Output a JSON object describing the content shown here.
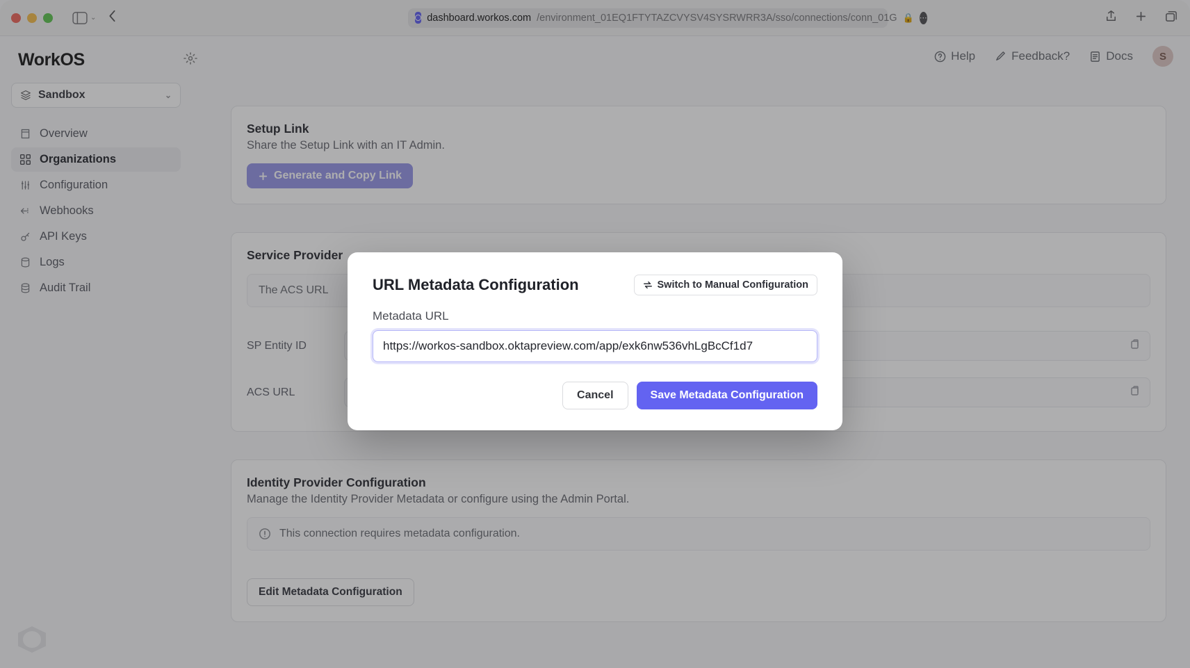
{
  "browser": {
    "url_host": "dashboard.workos.com",
    "url_path": "/environment_01EQ1FTYTAZCVYSV4SYSRWRR3A/sso/connections/conn_01G"
  },
  "brand": "WorkOS",
  "env": "Sandbox",
  "nav": {
    "overview": "Overview",
    "organizations": "Organizations",
    "configuration": "Configuration",
    "webhooks": "Webhooks",
    "apikeys": "API Keys",
    "logs": "Logs",
    "audit": "Audit Trail"
  },
  "topbar": {
    "help": "Help",
    "feedback": "Feedback?",
    "docs": "Docs",
    "avatar_initial": "S"
  },
  "setup": {
    "title": "Setup Link",
    "subtitle": "Share the Setup Link with an IT Admin.",
    "button": "Generate and Copy Link"
  },
  "sp": {
    "title": "Service Provider",
    "note_prefix": "The ACS URL",
    "entity_label": "SP Entity ID",
    "acs_label": "ACS URL"
  },
  "idp": {
    "title": "Identity Provider Configuration",
    "subtitle": "Manage the Identity Provider Metadata or configure using the Admin Portal.",
    "note": "This connection requires metadata configuration.",
    "edit_btn": "Edit Metadata Configuration"
  },
  "modal": {
    "title": "URL Metadata Configuration",
    "switch": "Switch to Manual Configuration",
    "field_label": "Metadata URL",
    "field_value": "https://workos-sandbox.oktapreview.com/app/exk6nw536vhLgBcCf1d7",
    "cancel": "Cancel",
    "save": "Save Metadata Configuration"
  }
}
